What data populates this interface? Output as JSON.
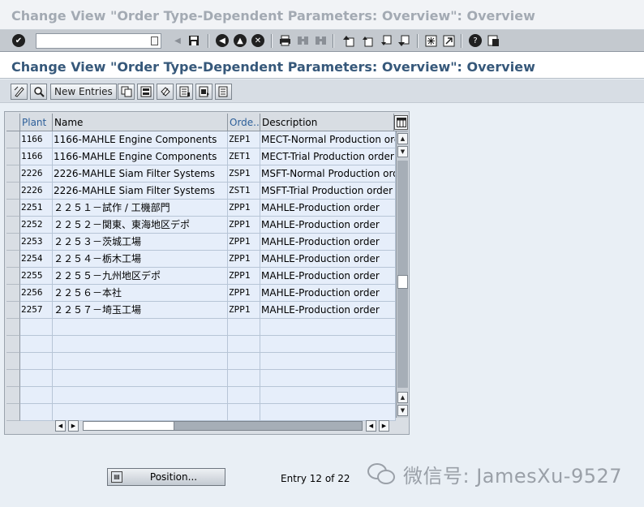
{
  "window": {
    "title": "Change View \"Order Type-Dependent Parameters: Overview\": Overview"
  },
  "system_toolbar": {
    "command_field_value": "",
    "icons": [
      "enter-icon",
      "back-icon",
      "save-icon",
      "back-arrow-icon",
      "exit-icon",
      "cancel-icon",
      "print-icon",
      "find-icon",
      "find-next-icon",
      "first-page-icon",
      "previous-page-icon",
      "next-page-icon",
      "last-page-icon",
      "create-session-icon",
      "shortcut-icon",
      "help-icon",
      "layout-icon"
    ]
  },
  "screen": {
    "title": "Change View \"Order Type-Dependent Parameters: Overview\": Overview"
  },
  "app_toolbar": {
    "new_entries_label": "New Entries"
  },
  "table": {
    "columns": [
      "Plant",
      "Name",
      "Orde...",
      "Description"
    ],
    "rows": [
      {
        "plant": "1166",
        "name": "1166-MAHLE Engine Components",
        "order_type": "ZEP1",
        "description": "MECT-Normal Production orde"
      },
      {
        "plant": "1166",
        "name": "1166-MAHLE Engine Components",
        "order_type": "ZET1",
        "description": "MECT-Trial Production order"
      },
      {
        "plant": "2226",
        "name": "2226-MAHLE Siam Filter Systems",
        "order_type": "ZSP1",
        "description": "MSFT-Normal Production orde"
      },
      {
        "plant": "2226",
        "name": "2226-MAHLE Siam Filter Systems",
        "order_type": "ZST1",
        "description": "MSFT-Trial Production order"
      },
      {
        "plant": "2251",
        "name": "２２５１－試作 / 工機部門",
        "order_type": "ZPP1",
        "description": "MAHLE-Production order"
      },
      {
        "plant": "2252",
        "name": "２２５２－関東、東海地区デポ",
        "order_type": "ZPP1",
        "description": "MAHLE-Production order"
      },
      {
        "plant": "2253",
        "name": "２２５３－茨城工場",
        "order_type": "ZPP1",
        "description": "MAHLE-Production order"
      },
      {
        "plant": "2254",
        "name": "２２５４－栃木工場",
        "order_type": "ZPP1",
        "description": "MAHLE-Production order"
      },
      {
        "plant": "2255",
        "name": "２２５５－九州地区デポ",
        "order_type": "ZPP1",
        "description": "MAHLE-Production order"
      },
      {
        "plant": "2256",
        "name": "２２５６－本社",
        "order_type": "ZPP1",
        "description": "MAHLE-Production order"
      },
      {
        "plant": "2257",
        "name": "２２５７－埼玉工場",
        "order_type": "ZPP1",
        "description": "MAHLE-Production order"
      }
    ],
    "empty_rows": 6
  },
  "footer": {
    "position_button_label": "Position...",
    "entry_text": "Entry 12 of 22"
  },
  "watermark": {
    "text": "微信号: JamesXu-9527"
  }
}
